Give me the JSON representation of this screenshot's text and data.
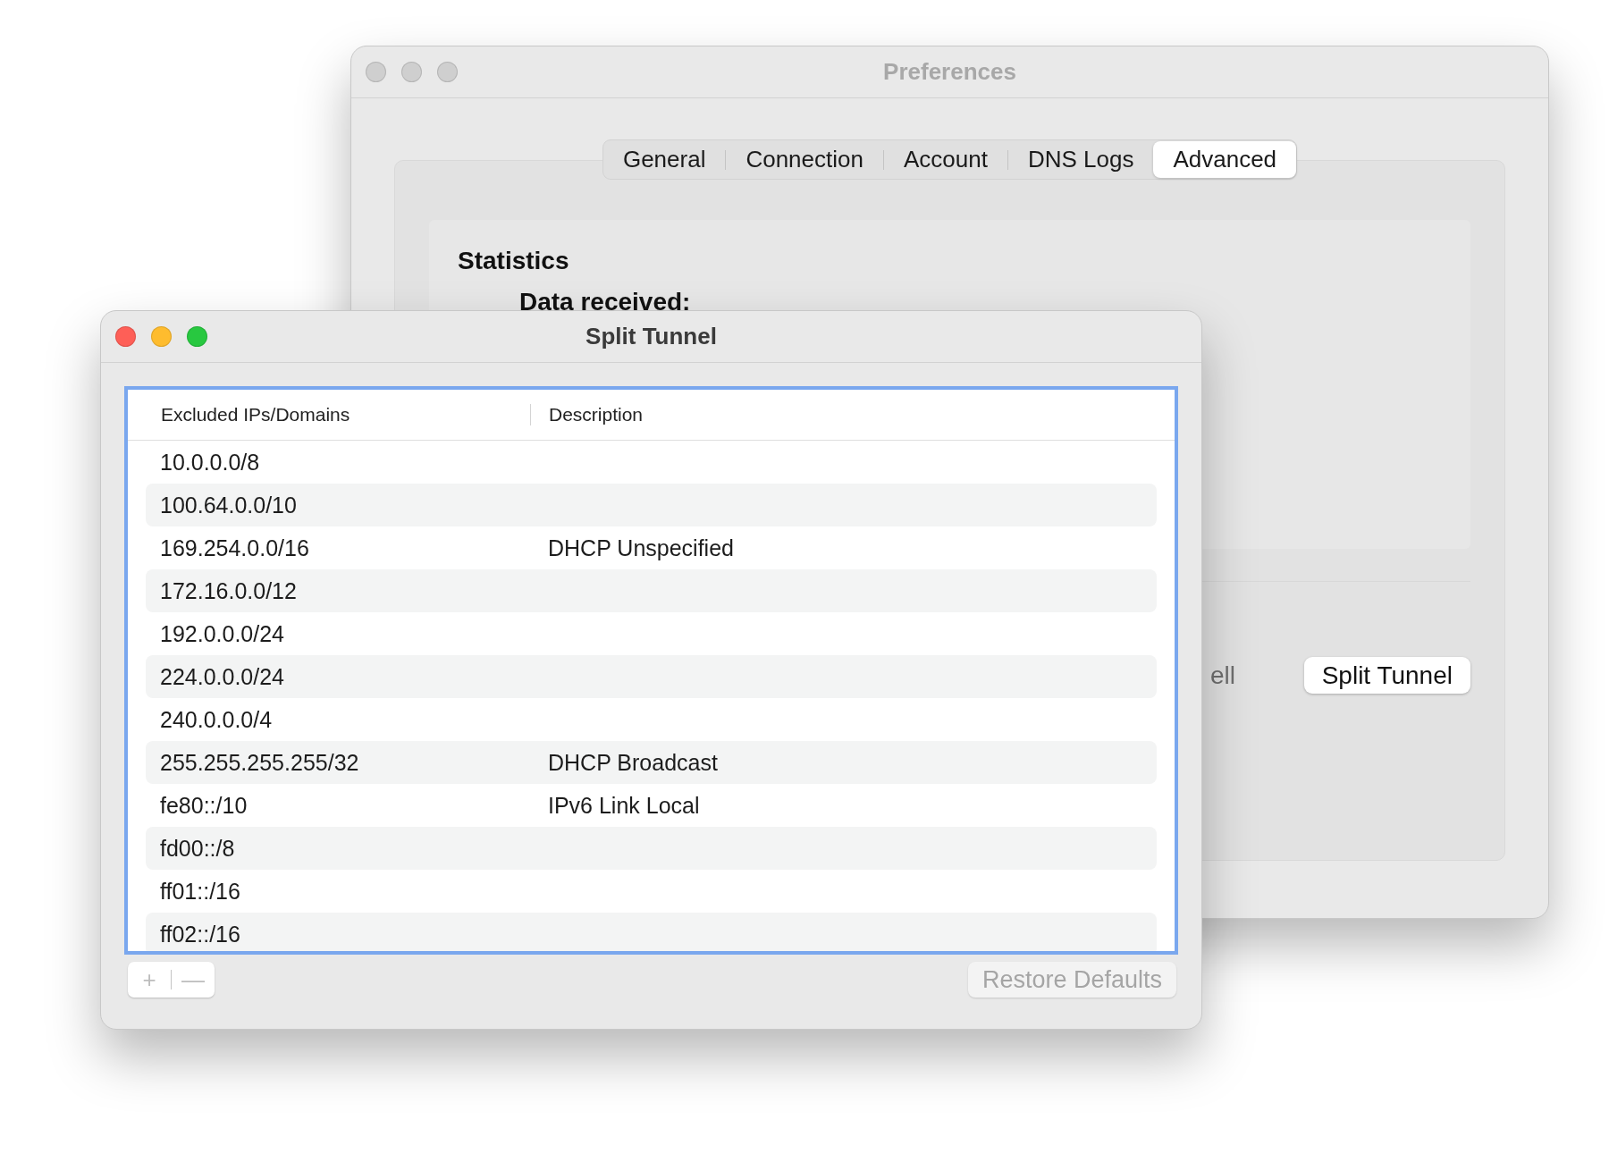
{
  "preferences_window": {
    "title": "Preferences",
    "active": false,
    "tabs": [
      {
        "label": "General",
        "selected": false
      },
      {
        "label": "Connection",
        "selected": false
      },
      {
        "label": "Account",
        "selected": false
      },
      {
        "label": "DNS Logs",
        "selected": false
      },
      {
        "label": "Advanced",
        "selected": true
      }
    ],
    "statistics": {
      "heading": "Statistics",
      "label": "Data received:"
    },
    "partial_label": "ell",
    "split_tunnel_button": "Split Tunnel"
  },
  "split_tunnel_window": {
    "title": "Split Tunnel",
    "active": true,
    "table": {
      "columns": [
        "Excluded IPs/Domains",
        "Description"
      ],
      "rows": [
        {
          "address": "10.0.0.0/8"
        },
        {
          "address": "100.64.0.0/10"
        },
        {
          "address": "169.254.0.0/16",
          "description": "DHCP Unspecified"
        },
        {
          "address": "172.16.0.0/12"
        },
        {
          "address": "192.0.0.0/24"
        },
        {
          "address": "224.0.0.0/24"
        },
        {
          "address": "240.0.0.0/4"
        },
        {
          "address": "255.255.255.255/32",
          "description": "DHCP Broadcast"
        },
        {
          "address": "fe80::/10",
          "description": "IPv6 Link Local"
        },
        {
          "address": "fd00::/8"
        },
        {
          "address": "ff01::/16"
        },
        {
          "address": "ff02::/16"
        }
      ]
    },
    "add_button": {
      "label": "+",
      "disabled": true
    },
    "remove_button": {
      "label": "—",
      "disabled": true
    },
    "restore_button": {
      "label": "Restore Defaults",
      "disabled": true
    }
  }
}
